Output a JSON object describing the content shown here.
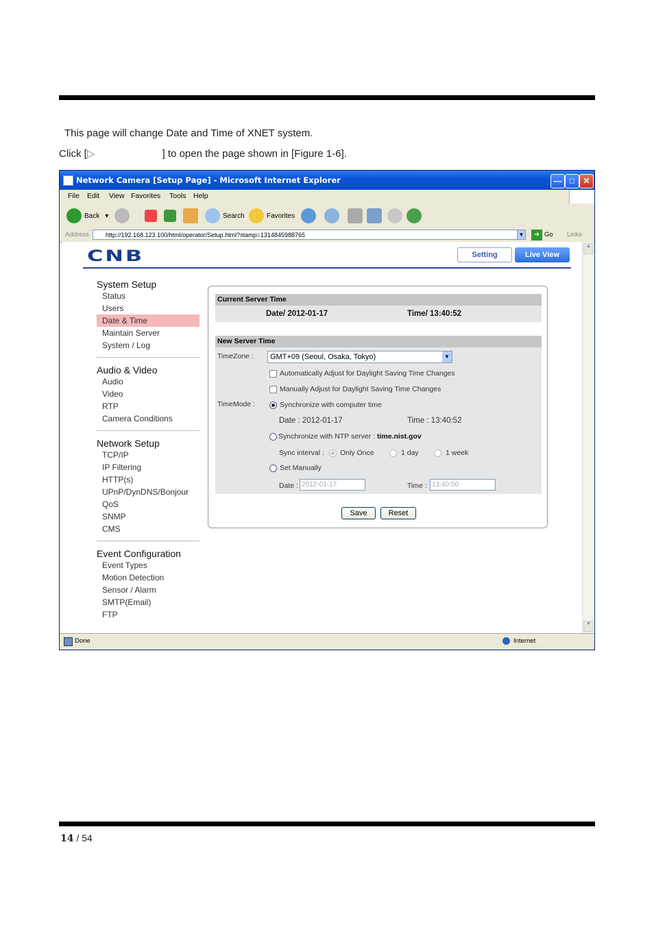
{
  "document": {
    "intro_line": "This page will change Date and Time of XNET system.",
    "click_prefix": "Click [",
    "click_suffix": "] to open the page shown in [Figure 1-6].",
    "page_number": "14",
    "page_total": "/ 54"
  },
  "browser": {
    "title": "Network Camera [Setup Page] - Microsoft Internet Explorer",
    "menu": [
      "File",
      "Edit",
      "View",
      "Favorites",
      "Tools",
      "Help"
    ],
    "toolbar": {
      "back": "Back",
      "search": "Search",
      "favorites": "Favorites"
    },
    "address_label": "Address",
    "address_url": "http://192.168.123.100/html/operator/Setup.html?stamp=1314845988765",
    "go_label": "Go",
    "links_label": "Links",
    "status_left": "Done",
    "status_right": "Internet"
  },
  "app": {
    "logo": "CNB",
    "setting_button": "Setting",
    "live_view_button": "Live View"
  },
  "nav": {
    "system_setup": {
      "title": "System Setup",
      "items": [
        "Status",
        "Users",
        "Date & Time",
        "Maintain Server",
        "System / Log"
      ]
    },
    "audio_video": {
      "title": "Audio & Video",
      "items": [
        "Audio",
        "Video",
        "RTP",
        "Camera Conditions"
      ]
    },
    "network_setup": {
      "title": "Network Setup",
      "items": [
        "TCP/IP",
        "IP Filtering",
        "HTTP(s)",
        "UPnP/DynDNS/Bonjour",
        "QoS",
        "SNMP",
        "CMS"
      ]
    },
    "event_config": {
      "title": "Event Configuration",
      "items": [
        "Event Types",
        "Motion Detection",
        "Sensor / Alarm",
        "SMTP(Email)",
        "FTP"
      ]
    },
    "active_item": "Date & Time"
  },
  "form": {
    "current_header": "Current Server Time",
    "current_date": "Date/ 2012-01-17",
    "current_time": "Time/ 13:40:52",
    "new_header": "New Server Time",
    "timezone_label": "TimeZone :",
    "timezone_value": "GMT+09 (Seoul, Osaka, Tokyo)",
    "auto_dst": "Automatically Adjust for Daylight Saving Time Changes",
    "manual_dst": "Manually Adjust for Daylight Saving Time Changes",
    "timemode_label": "TimeMode :",
    "sync_computer": "Synchronize with computer time",
    "sync_date": "Date : 2012-01-17",
    "sync_time": "Time : 13:40:52",
    "sync_ntp_prefix": "Synchronize with NTP server :",
    "ntp_server": "time.nist.gov",
    "sync_interval_label": "Sync interval :",
    "interval_options": [
      "Only Once",
      "1 day",
      "1 week"
    ],
    "set_manually": "Set Manually",
    "manual_date_label": "Date :",
    "manual_date_value": "2012-01-17",
    "manual_time_label": "Time :",
    "manual_time_value": "13:40:50",
    "save": "Save",
    "reset": "Reset"
  }
}
